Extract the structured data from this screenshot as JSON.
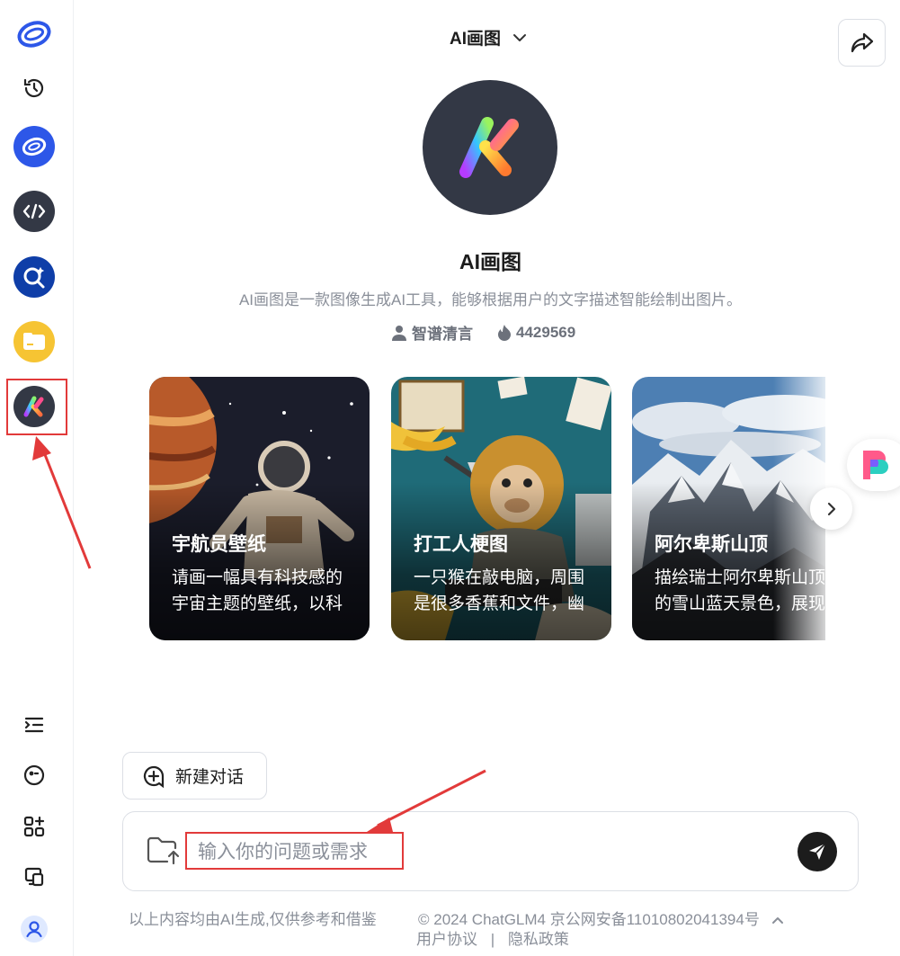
{
  "header": {
    "title": "AI画图"
  },
  "sidebar": {
    "items": [
      {
        "icon": "app-logo-icon"
      },
      {
        "icon": "history-icon"
      },
      {
        "icon": "chatglm-icon"
      },
      {
        "icon": "code-icon"
      },
      {
        "icon": "search-ai-icon"
      },
      {
        "icon": "folder-icon"
      },
      {
        "icon": "ai-draw-icon",
        "selected": true
      }
    ],
    "bottom_items": [
      {
        "icon": "collapse-menu-icon"
      },
      {
        "icon": "feedback-icon"
      },
      {
        "icon": "apps-add-icon"
      },
      {
        "icon": "devices-icon"
      },
      {
        "icon": "user-avatar-icon"
      }
    ]
  },
  "agent": {
    "name": "AI画图",
    "description": "AI画图是一款图像生成AI工具，能够根据用户的文字描述智能绘制出图片。",
    "author": "智谱清言",
    "count": "4429569"
  },
  "cards": [
    {
      "title": "宇航员壁纸",
      "desc": "请画一幅具有科技感的宇宙主题的壁纸，以科"
    },
    {
      "title": "打工人梗图",
      "desc": "一只猴在敲电脑，周围是很多香蕉和文件，幽"
    },
    {
      "title": "阿尔卑斯山顶",
      "desc": "描绘瑞士阿尔卑斯山顶的雪山蓝天景色，展现"
    }
  ],
  "actions": {
    "new_chat_label": "新建对话"
  },
  "input": {
    "placeholder": "输入你的问题或需求"
  },
  "footer": {
    "disclaimer": "以上内容均由AI生成,仅供参考和借鉴",
    "copyright": "© 2024 ChatGLM4 京公网安备11010802041394号",
    "user_agreement": "用户协议",
    "separator": "|",
    "privacy": "隐私政策"
  },
  "colors": {
    "accent_red": "#e23a3a",
    "agent_bg": "#333845",
    "brand_blue": "#2d57e8"
  }
}
